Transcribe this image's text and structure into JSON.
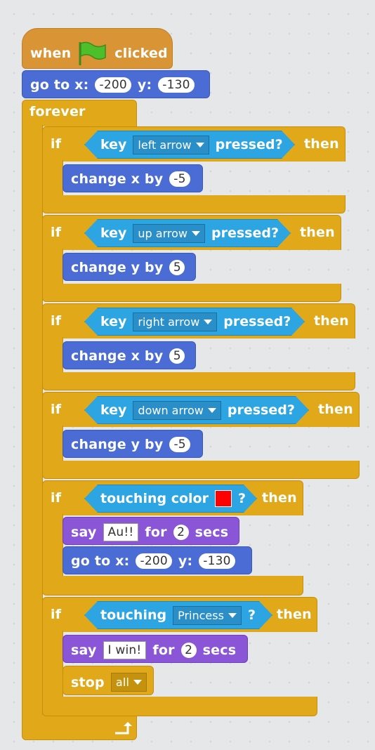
{
  "hat": {
    "when": "when",
    "clicked": "clicked"
  },
  "goto_top": {
    "label": "go to x:",
    "x": "-200",
    "ylabel": "y:",
    "y": "-130"
  },
  "forever": {
    "label": "forever"
  },
  "if_word": "if",
  "then_word": "then",
  "key_word": "key",
  "pressed_word": "pressed?",
  "if1": {
    "key": "left arrow",
    "action": "change x by",
    "value": "-5"
  },
  "if2": {
    "key": "up arrow",
    "action": "change y by",
    "value": "5"
  },
  "if3": {
    "key": "right arrow",
    "action": "change x by",
    "value": "5"
  },
  "if4": {
    "key": "down arrow",
    "action": "change y by",
    "value": "-5"
  },
  "if5": {
    "condition": "touching color",
    "q": "?",
    "color": "#ff0000",
    "say": "say",
    "message": "Au!!",
    "for": "for",
    "secs_value": "2",
    "secs": "secs",
    "goto": "go to x:",
    "x": "-200",
    "ylabel": "y:",
    "y": "-130"
  },
  "if6": {
    "condition": "touching",
    "target": "Princess",
    "q": "?",
    "say": "say",
    "message": "I win!",
    "for": "for",
    "secs_value": "2",
    "secs": "secs",
    "stop": "stop",
    "stop_option": "all"
  }
}
